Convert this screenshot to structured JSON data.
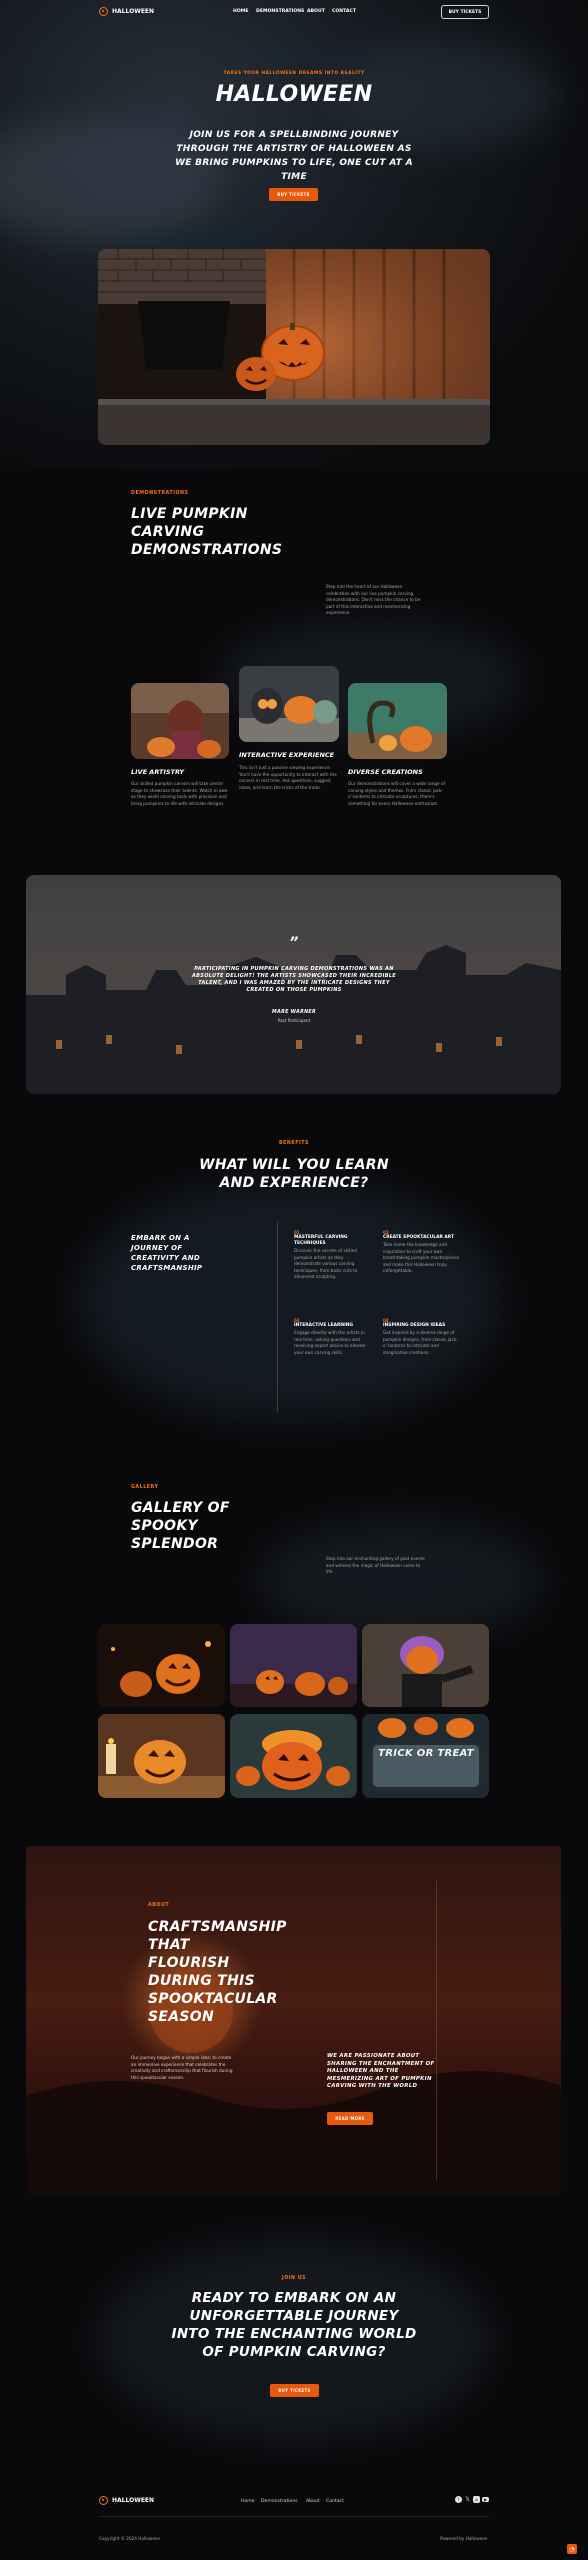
{
  "nav": {
    "brand": "HALLOWEEN",
    "links": [
      "HOME",
      "DEMONSTRATIONS",
      "ABOUT",
      "CONTACT"
    ],
    "cta": "BUY TICKETS"
  },
  "hero": {
    "eyebrow": "TAKES YOUR HALLOWEEN DREAMS INTO REALITY",
    "title": "HALLOWEEN",
    "subtitle": "JOIN US FOR A SPELLBINDING JOURNEY THROUGH THE ARTISTRY OF HALLOWEEN AS WE BRING PUMPKINS TO LIFE, ONE CUT AT A TIME",
    "cta": "BUY TICKETS"
  },
  "demos": {
    "label": "DEMONSTRATIONS",
    "title": "LIVE PUMPKIN CARVING DEMONSTRATIONS",
    "intro": "Step into the heart of our Halloween celebration with our live pumpkin carving demonstrations. Don't miss the chance to be part of this interactive and mesmerizing experience.",
    "cards": [
      {
        "title": "LIVE ARTISTRY",
        "text": "Our skilled pumpkin carvers will take center stage to showcase their talents. Watch in awe as they wield carving tools with precision and bring pumpkins to life with intricate designs."
      },
      {
        "title": "INTERACTIVE EXPERIENCE",
        "text": "This isn't just a passive viewing experience. You'll have the opportunity to interact with the carvers in real time. Ask questions, suggest ideas, and learn the tricks of the trade."
      },
      {
        "title": "DIVERSE CREATIONS",
        "text": "Our demonstrations will cover a wide range of carving styles and themes. From classic jack-o'-lanterns to intricate sculptures, there's something for every Halloween enthusiast."
      }
    ]
  },
  "testimonial": {
    "quote_mark": "”",
    "quote": "PARTICIPATING IN PUMPKIN CARVING DEMONSTRATIONS WAS AN ABSOLUTE DELIGHT! THE ARTISTS SHOWCASED THEIR INCREDIBLE TALENT, AND I WAS AMAZED BY THE INTRICATE DESIGNS THEY CREATED ON THOSE PUMPKINS",
    "name": "MARE WARNER",
    "role": "Past Participant"
  },
  "benefits": {
    "label": "BENEFITS",
    "title": "WHAT WILL YOU LEARN AND EXPERIENCE?",
    "lead": "EMBARK ON A JOURNEY OF CREATIVITY AND CRAFTSMANSHIP",
    "items": [
      {
        "num": "01",
        "title": "MASTERFUL CARVING TECHNIQUES",
        "text": "Discover the secrets of skilled pumpkin artists as they demonstrate various carving techniques, from basic cuts to advanced sculpting."
      },
      {
        "num": "02",
        "title": "CREATE SPOOKTACULAR ART",
        "text": "Take home the knowledge and inspiration to craft your own breathtaking pumpkin masterpieces and make this Halloween truly unforgettable."
      },
      {
        "num": "03",
        "title": "INTERACTIVE LEARNING",
        "text": "Engage directly with the artists in real time, asking questions and receiving expert advice to elevate your own carving skills."
      },
      {
        "num": "04",
        "title": "INSPIRING DESIGN IDEAS",
        "text": "Get inspired by a diverse range of pumpkin designs, from classic jack-o'-lanterns to intricate and imaginative creations."
      }
    ]
  },
  "gallery": {
    "label": "GALLERY",
    "title": "GALLERY OF SPOOKY SPLENDOR",
    "intro": "Step into our enchanting gallery of past events and witness the magic of Halloween come to life.",
    "trick_text": "TRICK OR TREAT"
  },
  "about": {
    "label": "ABOUT",
    "title": "CRAFTSMANSHIP THAT FLOURISH DURING THIS SPOOKTACULAR SEASON",
    "text": "Our journey began with a simple idea: to create an immersive experience that celebrates the creativity and craftsmanship that flourish during this spooktacular season.",
    "mission": "WE ARE PASSIONATE ABOUT SHARING THE ENCHANTMENT OF HALLOWEEN AND THE MESMERIZING ART OF PUMPKIN CARVING WITH THE WORLD",
    "cta": "READ MORE"
  },
  "join": {
    "label": "JOIN US",
    "title": "READY TO EMBARK ON AN UNFORGETTABLE JOURNEY INTO THE ENCHANTING WORLD OF PUMPKIN CARVING?",
    "cta": "BUY TICKETS"
  },
  "footer": {
    "brand": "HALLOWEEN",
    "links": [
      "Home",
      "Demonstrations",
      "About",
      "Contact"
    ],
    "copyright": "Copyright © 2024 Halloween",
    "powered": "Powered by Halloween"
  },
  "colors": {
    "accent": "#ea580c",
    "accent_text": "#f97316",
    "background": "#09090b"
  },
  "icons": [
    "pumpkin-logo-icon",
    "quote-icon",
    "facebook-icon",
    "twitter-icon",
    "instagram-icon",
    "youtube-icon",
    "rss-icon"
  ]
}
